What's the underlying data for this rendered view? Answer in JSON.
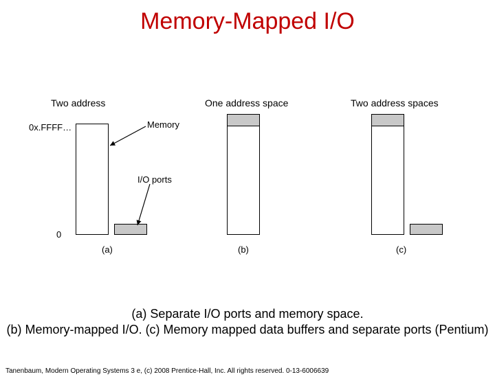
{
  "title": "Memory-Mapped I/O",
  "labels": {
    "colA": "Two address",
    "colB": "One address space",
    "colC": "Two address spaces",
    "axisTop": "0x.FFFF…",
    "axisBottom": "0",
    "memory": "Memory",
    "ioports": "I/O ports",
    "subA": "(a)",
    "subB": "(b)",
    "subC": "(c)"
  },
  "caption_a": "(a) Separate I/O ports and memory space.",
  "caption_bc": "(b) Memory-mapped I/O. (c) Memory mapped data buffers and separate ports (Pentium)",
  "footer": "Tanenbaum, Modern Operating Systems 3 e, (c) 2008 Prentice-Hall, Inc. All rights reserved. 0-13-6006639"
}
